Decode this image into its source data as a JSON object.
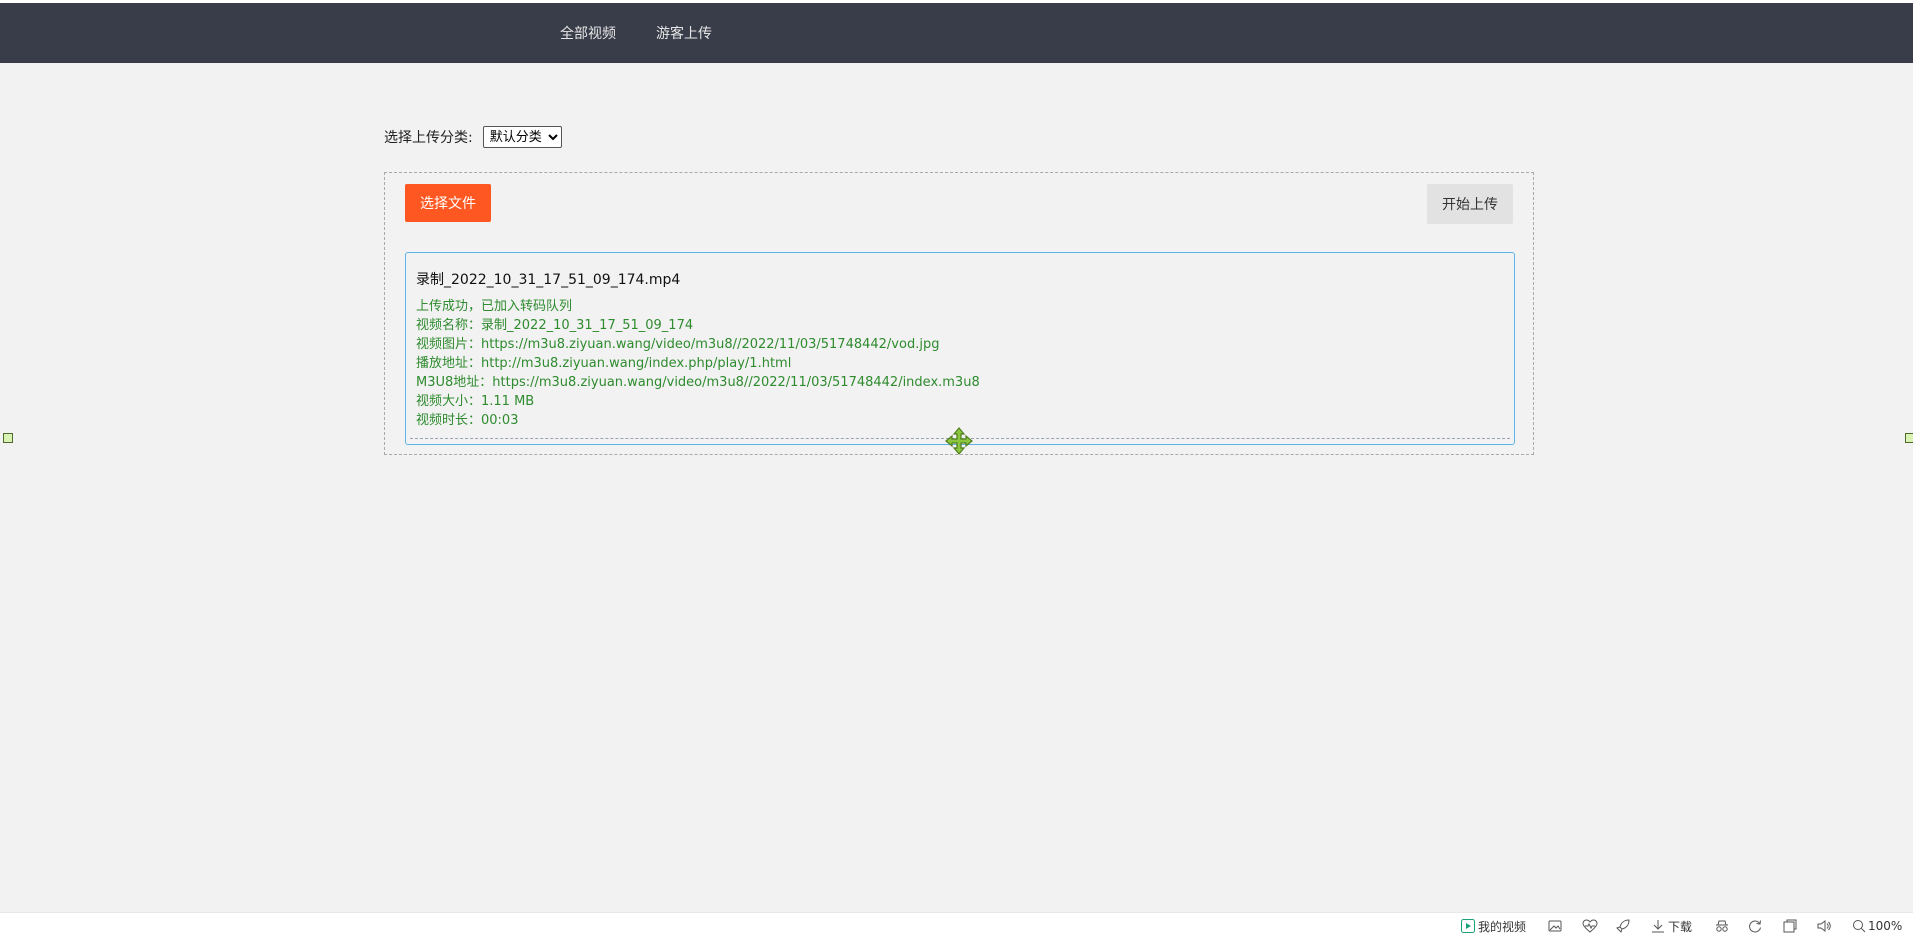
{
  "nav": {
    "items": [
      {
        "label": "全部视频"
      },
      {
        "label": "游客上传"
      }
    ]
  },
  "upload": {
    "category_label": "选择上传分类:",
    "category_selected": "默认分类",
    "pick_label": "选择文件",
    "start_label": "开始上传"
  },
  "file": {
    "name": "录制_2022_10_31_17_51_09_174.mp4",
    "lines": [
      "上传成功，已加入转码队列",
      "视频名称：录制_2022_10_31_17_51_09_174",
      "视频图片：https://m3u8.ziyuan.wang/video/m3u8//2022/11/03/51748442/vod.jpg",
      "播放地址：http://m3u8.ziyuan.wang/index.php/play/1.html",
      "M3U8地址：https://m3u8.ziyuan.wang/video/m3u8//2022/11/03/51748442/index.m3u8",
      "视频大小：1.11 MB",
      "视频时长：00:03"
    ]
  },
  "statusbar": {
    "my_videos": "我的视频",
    "download": "下载",
    "zoom": "100%"
  },
  "colors": {
    "navbar": "#393d49",
    "accent": "#ff5722",
    "success_text": "#2e8b2e",
    "card_border": "#5fb4e6"
  },
  "icons": [
    "play-icon",
    "image-icon",
    "heart-pulse-icon",
    "rocket-icon",
    "download-icon",
    "incognito-icon",
    "refresh-icon",
    "window-icon",
    "speaker-icon",
    "zoom-icon",
    "move-cursor-icon"
  ]
}
